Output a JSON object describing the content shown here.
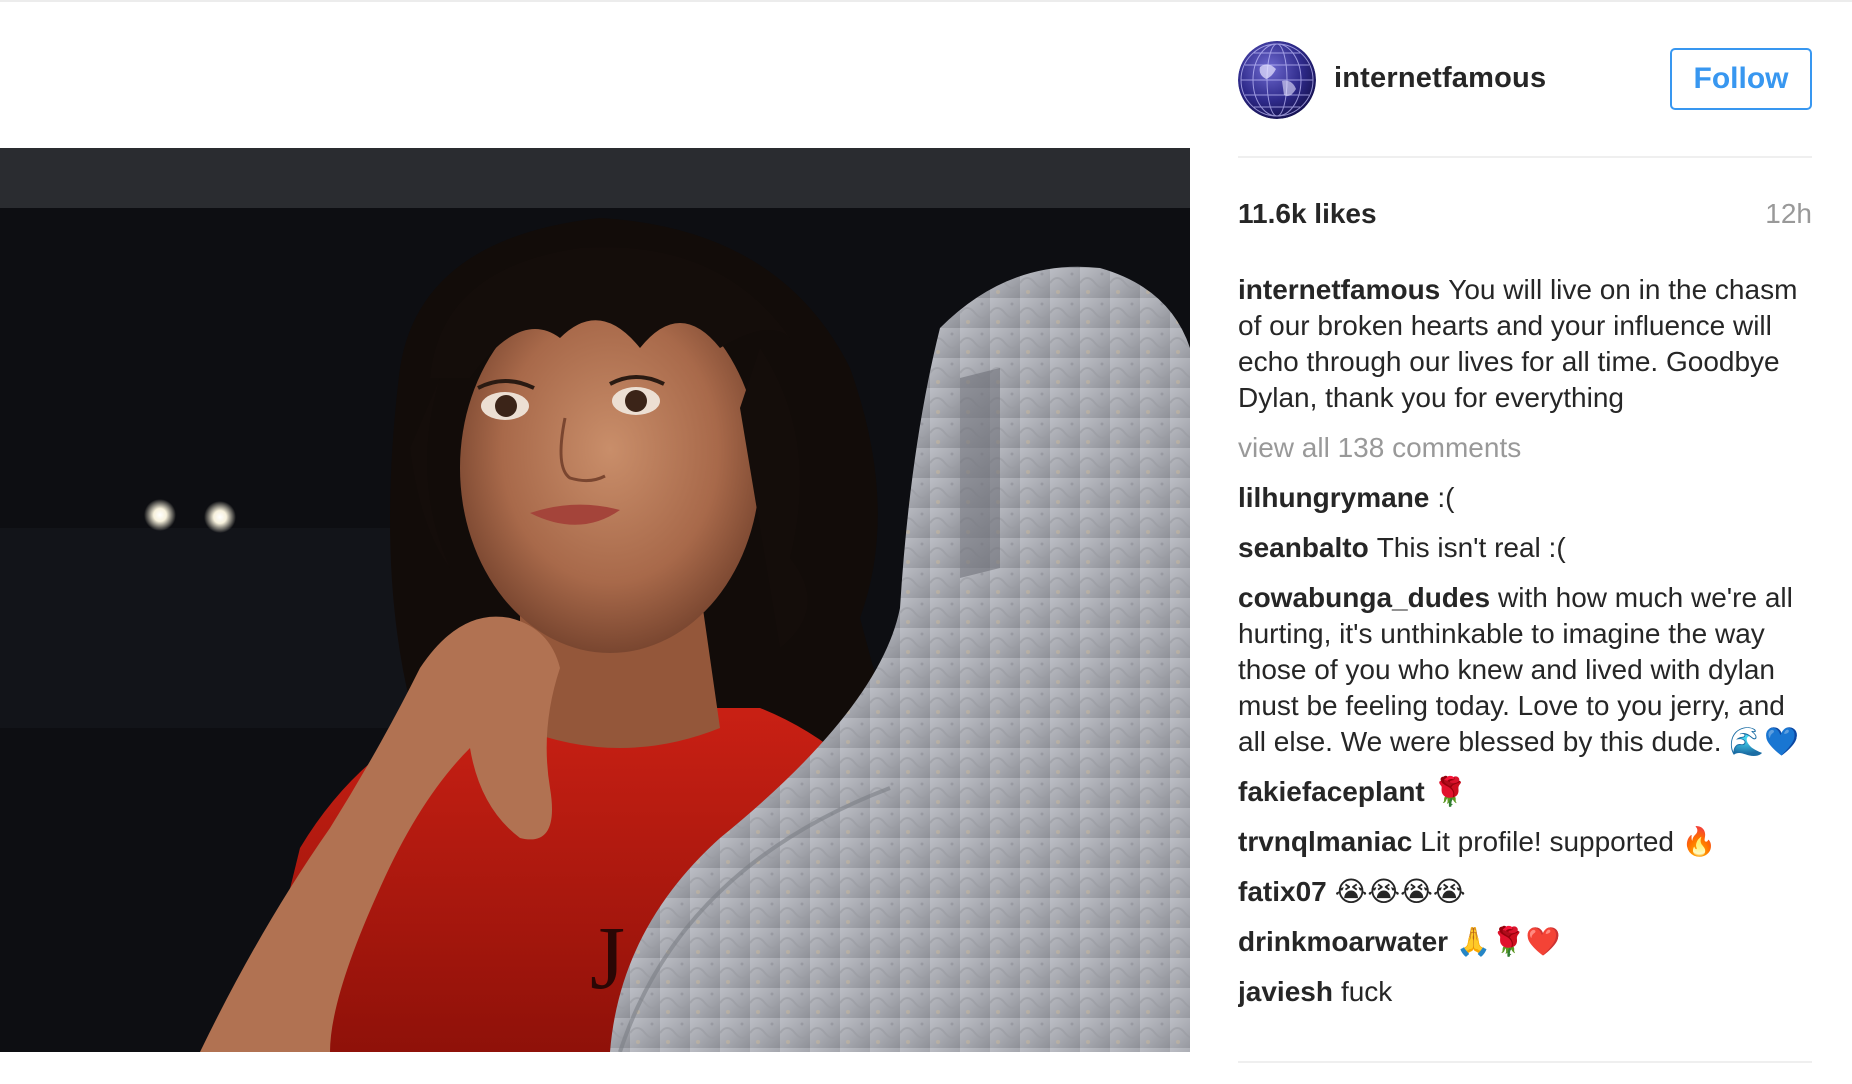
{
  "post": {
    "username": "internetfamous",
    "follow_label": "Follow",
    "likes": "11.6k likes",
    "time": "12h",
    "caption_user": "internetfamous",
    "caption_text": "You will live on in the chasm of our broken hearts and your influence will echo through our lives for all time. Goodbye Dylan, thank you for everything",
    "view_all": "view all 138 comments",
    "comments": [
      {
        "user": "lilhungrymane",
        "text": ":("
      },
      {
        "user": "seanbalto",
        "text": "This isn't real :("
      },
      {
        "user": "cowabunga_dudes",
        "text": "with how much we're all hurting, it's unthinkable to imagine the way those of you who knew and lived with dylan must be feeling today. Love to you jerry, and all else. We were blessed by this dude. 🌊💙"
      },
      {
        "user": "fakiefaceplant",
        "text": "🌹"
      },
      {
        "user": "trvnqlmaniac",
        "text": "Lit profile! supported 🔥"
      },
      {
        "user": "fatix07",
        "text": "😭😭😭😭"
      },
      {
        "user": "drinkmoarwater",
        "text": "🙏🌹❤️"
      },
      {
        "user": "javiesh",
        "text": "fuck"
      }
    ]
  },
  "colors": {
    "accent": "#3897f0",
    "text": "#262626",
    "muted": "#999999",
    "divider": "#efefef"
  },
  "icons": {
    "avatar": "globe-avatar-icon"
  }
}
